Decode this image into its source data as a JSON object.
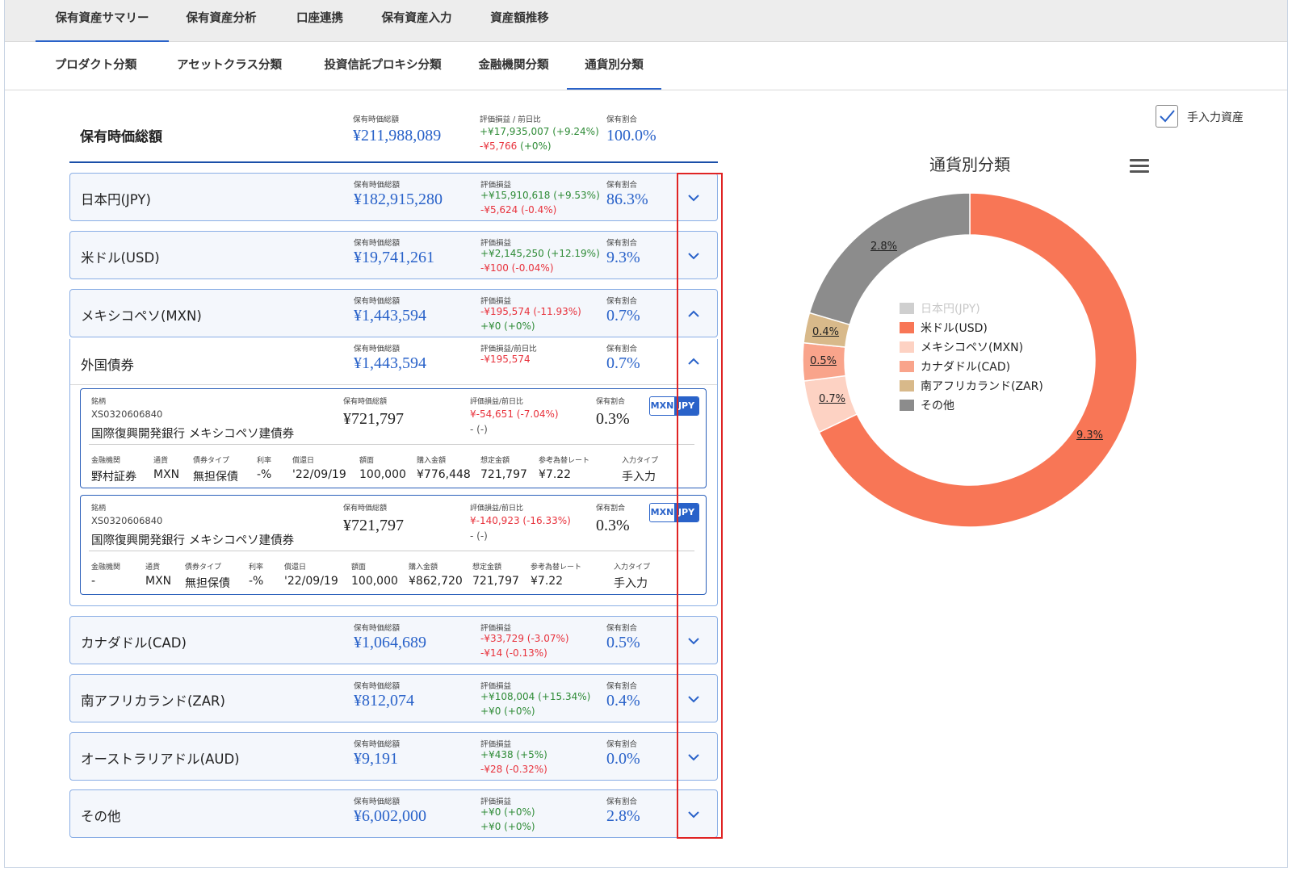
{
  "tabs_top": [
    "保有資産サマリー",
    "保有資産分析",
    "口座連携",
    "保有資産入力",
    "資産額推移"
  ],
  "tabs_sub": [
    "プロダクト分類",
    "アセットクラス分類",
    "投資信託プロキシ分類",
    "金融機関分類",
    "通貨別分類"
  ],
  "total": {
    "title": "保有時価総額",
    "label_value": "保有時価総額",
    "value": "¥211,988,089",
    "label_pl": "評価損益 / 前日比",
    "pl": "+¥17,935,007 (+9.24%)",
    "day": "-¥5,766",
    "day_pct": "(+0%)",
    "label_ratio": "保有割合",
    "ratio": "100.0%"
  },
  "labels": {
    "value": "保有時価総額",
    "pl": "評価損益",
    "ratio": "保有割合",
    "pl_day": "評価損益/前日比",
    "issue": "銘柄"
  },
  "categories": [
    {
      "name": "日本円(JPY)",
      "value": "¥182,915,280",
      "pl": "+¥15,910,618 (+9.53%)",
      "day": "-¥5,624 (-0.4%)",
      "ratio": "86.3%"
    },
    {
      "name": "米ドル(USD)",
      "value": "¥19,741,261",
      "pl": "+¥2,145,250 (+12.19%)",
      "day": "-¥100 (-0.04%)",
      "ratio": "9.3%"
    },
    {
      "name": "メキシコペソ(MXN)",
      "value": "¥1,443,594",
      "pl": "-¥195,574 (-11.93%)",
      "day": "+¥0 (+0%)",
      "ratio": "0.7%"
    },
    {
      "name": "カナダドル(CAD)",
      "value": "¥1,064,689",
      "pl": "-¥33,729 (-3.07%)",
      "day": "-¥14 (-0.13%)",
      "ratio": "0.5%"
    },
    {
      "name": "南アフリカランド(ZAR)",
      "value": "¥812,074",
      "pl": "+¥108,004 (+15.34%)",
      "day": "+¥0 (+0%)",
      "ratio": "0.4%"
    },
    {
      "name": "オーストラリアドル(AUD)",
      "value": "¥9,191",
      "pl": "+¥438 (+5%)",
      "day": "-¥28 (-0.32%)",
      "ratio": "0.0%"
    },
    {
      "name": "その他",
      "value": "¥6,002,000",
      "pl": "+¥0 (+0%)",
      "day": "+¥0 (+0%)",
      "ratio": "2.8%"
    }
  ],
  "subcategory": {
    "name": "外国債券",
    "value": "¥1,443,594",
    "pl": "-¥195,574",
    "ratio": "0.7%"
  },
  "bond_detail_labels": [
    "金融機関",
    "通貨",
    "債券タイプ",
    "利率",
    "償還日",
    "額面",
    "購入金額",
    "想定金額",
    "参考為替レート",
    "入力タイプ"
  ],
  "bonds": [
    {
      "code": "XS0320606840",
      "name": "国際復興開発銀行 メキシコペソ建債券",
      "value": "¥721,797",
      "pl": "¥-54,651 (-7.04%)",
      "day": "- (-)",
      "ratio": "0.3%",
      "toggle": [
        "MXN",
        "JPY"
      ],
      "details": [
        "野村証券",
        "MXN",
        "無担保債",
        "-%",
        "'22/09/19",
        "100,000",
        "¥776,448",
        "721,797",
        "¥7.22",
        "手入力"
      ]
    },
    {
      "code": "XS0320606840",
      "name": "国際復興開発銀行 メキシコペソ建債券",
      "value": "¥721,797",
      "pl": "¥-140,923 (-16.33%)",
      "day": "- (-)",
      "ratio": "0.3%",
      "toggle": [
        "MXN",
        "JPY"
      ],
      "details": [
        "-",
        "MXN",
        "無担保債",
        "-%",
        "'22/09/19",
        "100,000",
        "¥862,720",
        "721,797",
        "¥7.22",
        "手入力"
      ]
    }
  ],
  "manual_asset_label": "手入力資産",
  "chart_data": {
    "type": "pie",
    "title": "通貨別分類",
    "donut": true,
    "legend_position": "center",
    "categories": [
      "日本円(JPY)",
      "米ドル(USD)",
      "メキシコペソ(MXN)",
      "カナダドル(CAD)",
      "南アフリカランド(ZAR)",
      "その他"
    ],
    "values": [
      86.3,
      9.3,
      0.7,
      0.5,
      0.4,
      2.8
    ],
    "visible": [
      false,
      true,
      true,
      true,
      true,
      true
    ],
    "colors": [
      "#cfcfcf",
      "#f87656",
      "#fdd2c3",
      "#f9a48b",
      "#d8b98a",
      "#8c8c8c"
    ],
    "labels": [
      "",
      "9.3%",
      "0.7%",
      "0.5%",
      "0.4%",
      "2.8%"
    ]
  }
}
